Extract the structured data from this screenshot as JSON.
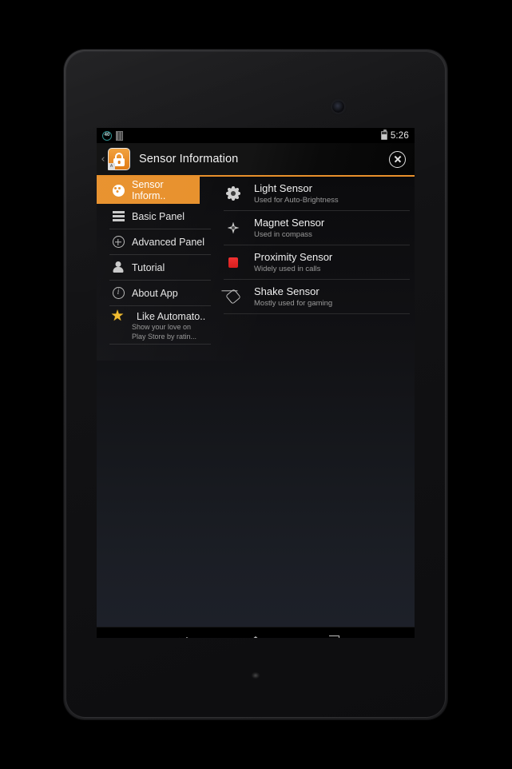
{
  "status_bar": {
    "badge_count": "40",
    "badge_icon": "circle-count-icon",
    "sd_icon": "sd-card-icon",
    "battery_icon": "battery-icon",
    "time": "5:26"
  },
  "action_bar": {
    "up_caret": "‹",
    "app_icon": "lock-app-icon",
    "icon_corner_label": "A",
    "title": "Sensor Information",
    "close_icon": "close-circle-icon"
  },
  "sidebar": {
    "items": [
      {
        "label": "Sensor Inform..",
        "icon": "gauge-icon",
        "selected": true
      },
      {
        "label": "Basic Panel",
        "icon": "list-icon",
        "selected": false
      },
      {
        "label": "Advanced Panel",
        "icon": "plus-circle-icon",
        "selected": false
      },
      {
        "label": "Tutorial",
        "icon": "person-icon",
        "selected": false
      },
      {
        "label": "About App",
        "icon": "info-circle-icon",
        "selected": false
      }
    ],
    "promo": {
      "label": "Like Automato..",
      "sub_line1": "Show your love on",
      "sub_line2": "Play Store by ratin...",
      "icon": "star-icon"
    }
  },
  "content": {
    "sensors": [
      {
        "title": "Light Sensor",
        "subtitle": "Used for Auto-Brightness",
        "icon": "sun-icon"
      },
      {
        "title": "Magnet Sensor",
        "subtitle": "Used in compass",
        "icon": "compass-icon"
      },
      {
        "title": "Proximity Sensor",
        "subtitle": "Widely used in calls",
        "icon": "red-square-icon"
      },
      {
        "title": "Shake Sensor",
        "subtitle": "Mostly used for gaming",
        "icon": "shake-icon"
      }
    ]
  },
  "nav_bar": {
    "back": "↩",
    "back_icon": "back-arrow-icon",
    "home_icon": "home-icon",
    "recents_icon": "recents-icon"
  },
  "colors": {
    "accent_orange": "#e8902b",
    "proximity_red": "#e02020",
    "star_yellow": "#f0bb2e",
    "screen_bg": "#0b0b0d"
  }
}
